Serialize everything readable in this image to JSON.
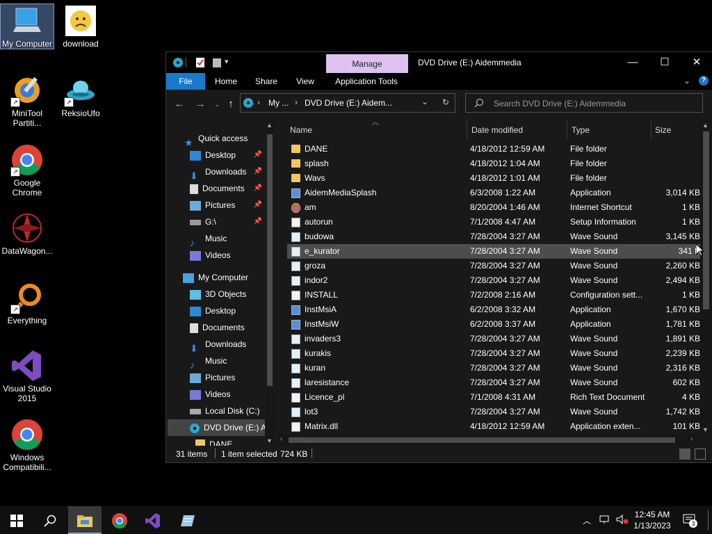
{
  "desktop": {
    "icons": [
      {
        "label": "My Computer"
      },
      {
        "label": "download"
      },
      {
        "label": "MiniTool Partiti..."
      },
      {
        "label": "ReksioUfo"
      },
      {
        "label": "Google Chrome"
      },
      {
        "label": "DataWagon..."
      },
      {
        "label": "Everything"
      },
      {
        "label": "Visual Studio 2015"
      },
      {
        "label": "Windows Compatibili..."
      }
    ]
  },
  "window": {
    "title": "DVD Drive (E:) Aidemmedia",
    "context_tab": "Manage",
    "controls": {
      "minimize": "—",
      "maximize": "☐",
      "close": "✕"
    },
    "ribbon_tabs": [
      "File",
      "Home",
      "Share",
      "View",
      "Application Tools"
    ],
    "address": {
      "seg1": "My ...",
      "seg2": "DVD Drive (E:) Aidem..."
    },
    "search_placeholder": "Search DVD Drive (E:) Aidemmedia"
  },
  "nav_pane": {
    "quick_access": "Quick access",
    "quick_items": [
      "Desktop",
      "Downloads",
      "Documents",
      "Pictures",
      "G:\\",
      "Music",
      "Videos"
    ],
    "computer": "My Computer",
    "computer_items": [
      "3D Objects",
      "Desktop",
      "Documents",
      "Downloads",
      "Music",
      "Pictures",
      "Videos",
      "Local Disk (C:)",
      "DVD Drive (E:) Ai"
    ],
    "sub_item": "DANE"
  },
  "columns": {
    "name": "Name",
    "date": "Date modified",
    "type": "Type",
    "size": "Size"
  },
  "files": [
    {
      "name": "DANE",
      "date": "4/18/2012 12:59 AM",
      "type": "File folder",
      "size": "",
      "icon": "folder-icon"
    },
    {
      "name": "splash",
      "date": "4/18/2012 1:04 AM",
      "type": "File folder",
      "size": "",
      "icon": "folder-icon"
    },
    {
      "name": "Wavs",
      "date": "4/18/2012 1:01 AM",
      "type": "File folder",
      "size": "",
      "icon": "folder-icon"
    },
    {
      "name": "AidemMediaSplash",
      "date": "6/3/2008 1:22 AM",
      "type": "Application",
      "size": "3,014 KB",
      "icon": "application-icon"
    },
    {
      "name": "am",
      "date": "8/20/2004 1:46 AM",
      "type": "Internet Shortcut",
      "size": "1 KB",
      "icon": "internet-shortcut-icon"
    },
    {
      "name": "autorun",
      "date": "7/1/2008 4:47 AM",
      "type": "Setup Information",
      "size": "1 KB",
      "icon": "text-file-icon"
    },
    {
      "name": "budowa",
      "date": "7/28/2004 3:27 AM",
      "type": "Wave Sound",
      "size": "3,145 KB",
      "icon": "wave-sound-icon"
    },
    {
      "name": "e_kurator",
      "date": "7/28/2004 3:27 AM",
      "type": "Wave Sound",
      "size": "341 K",
      "icon": "wave-sound-icon"
    },
    {
      "name": "groza",
      "date": "7/28/2004 3:27 AM",
      "type": "Wave Sound",
      "size": "2,260 KB",
      "icon": "wave-sound-icon"
    },
    {
      "name": "indor2",
      "date": "7/28/2004 3:27 AM",
      "type": "Wave Sound",
      "size": "2,494 KB",
      "icon": "wave-sound-icon"
    },
    {
      "name": "INSTALL",
      "date": "7/2/2008 2:16 AM",
      "type": "Configuration sett...",
      "size": "1 KB",
      "icon": "text-file-icon"
    },
    {
      "name": "InstMsiA",
      "date": "6/2/2008 3:32 AM",
      "type": "Application",
      "size": "1,670 KB",
      "icon": "application-icon"
    },
    {
      "name": "InstMsiW",
      "date": "6/2/2008 3:37 AM",
      "type": "Application",
      "size": "1,781 KB",
      "icon": "application-icon"
    },
    {
      "name": "invaders3",
      "date": "7/28/2004 3:27 AM",
      "type": "Wave Sound",
      "size": "1,891 KB",
      "icon": "wave-sound-icon"
    },
    {
      "name": "kurakis",
      "date": "7/28/2004 3:27 AM",
      "type": "Wave Sound",
      "size": "2,239 KB",
      "icon": "wave-sound-icon"
    },
    {
      "name": "kuran",
      "date": "7/28/2004 3:27 AM",
      "type": "Wave Sound",
      "size": "2,316 KB",
      "icon": "wave-sound-icon"
    },
    {
      "name": "laresistance",
      "date": "7/28/2004 3:27 AM",
      "type": "Wave Sound",
      "size": "602 KB",
      "icon": "wave-sound-icon"
    },
    {
      "name": "Licence_pl",
      "date": "7/1/2008 4:31 AM",
      "type": "Rich Text Document",
      "size": "4 KB",
      "icon": "text-file-icon"
    },
    {
      "name": "lot3",
      "date": "7/28/2004 3:27 AM",
      "type": "Wave Sound",
      "size": "1,742 KB",
      "icon": "wave-sound-icon"
    },
    {
      "name": "Matrix.dll",
      "date": "4/18/2012 12:59 AM",
      "type": "Application exten...",
      "size": "101 KB",
      "icon": "text-file-icon"
    }
  ],
  "status": {
    "count": "31 items",
    "selected": "1 item selected",
    "size": "724 KB"
  },
  "taskbar": {
    "time": "12:45 AM",
    "date": "1/13/2023",
    "notifications": "3"
  }
}
